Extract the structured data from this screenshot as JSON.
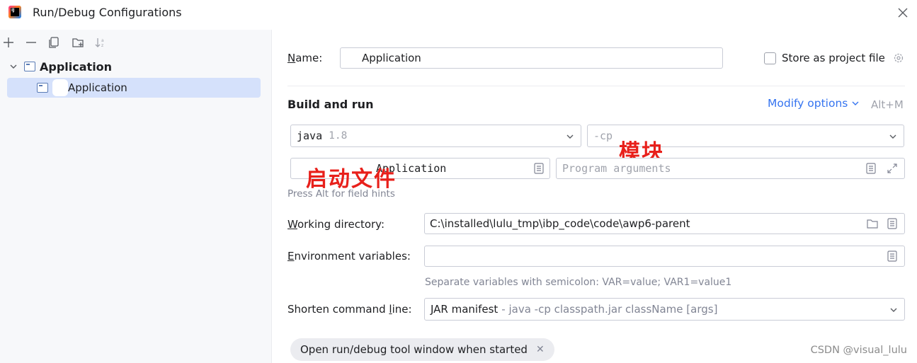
{
  "window": {
    "title": "Run/Debug Configurations"
  },
  "toolbar": {
    "add_icon": "plus-icon",
    "remove_icon": "minus-icon",
    "copy_icon": "copy-icon",
    "new_folder_icon": "new-folder-icon",
    "sort_icon": "sort-icon"
  },
  "tree": {
    "parent_label": "Application",
    "child_label": "Application"
  },
  "form": {
    "name_label": "Name:",
    "name_value": "Application",
    "store_label": "Store as project file",
    "build_run_title": "Build and run",
    "modify_options": "Modify options",
    "modify_shortcut": "Alt+M",
    "jdk_value": "java",
    "jdk_version": "1.8",
    "classpath_prefix": "-cp",
    "main_class_value": "Application",
    "program_args_placeholder": "Program arguments",
    "field_hint": "Press Alt for field hints",
    "working_dir_label": "Working directory:",
    "working_dir_value": "C:\\installed\\lulu_tmp\\ibp_code\\code\\awp6-parent",
    "env_label": "Environment variables:",
    "env_value": "",
    "env_hint": "Separate variables with semicolon: VAR=value; VAR1=value1",
    "shorten_label": "Shorten command line:",
    "shorten_value": "JAR manifest",
    "shorten_desc": "- java -cp classpath.jar className [args]",
    "chip_label": "Open run/debug tool window when started"
  },
  "annotations": {
    "module": "模块",
    "startup_file": "启动文件"
  },
  "watermark": "CSDN @visual_lulu",
  "colors": {
    "accent": "#3574f0",
    "selection": "#d5e1fb",
    "annotation_red": "#e8201b"
  }
}
